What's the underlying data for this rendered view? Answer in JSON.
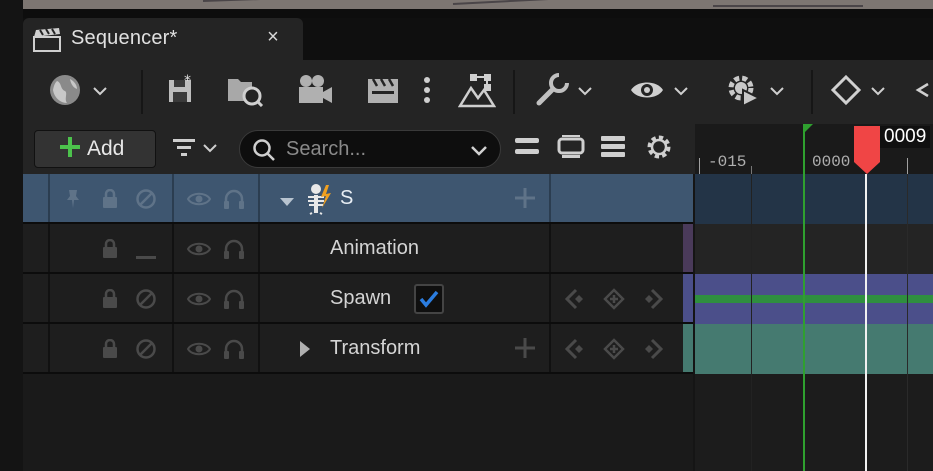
{
  "tab": {
    "title": "Sequencer*",
    "close": "×"
  },
  "toolbar": {
    "items": [
      {
        "name": "world-icon"
      },
      {
        "name": "save-icon"
      },
      {
        "name": "find-asset-icon"
      },
      {
        "name": "camera-icon"
      },
      {
        "name": "clapper-icon"
      },
      {
        "name": "more-icon"
      },
      {
        "name": "render-icon"
      },
      {
        "name": "wrench-icon"
      },
      {
        "name": "eye-icon"
      },
      {
        "name": "gear-play-icon"
      },
      {
        "name": "key-diamond-icon"
      }
    ]
  },
  "filter": {
    "add_label": "Add",
    "search_placeholder": "Search..."
  },
  "outliner": {
    "rows": [
      {
        "label": "S",
        "selected": true,
        "type": "skeletal-actor"
      },
      {
        "label": "Animation"
      },
      {
        "label": "Spawn",
        "checked": true
      },
      {
        "label": "Transform"
      }
    ]
  },
  "timeline": {
    "ticks": [
      "-015",
      "0000"
    ],
    "current_frame": "0009"
  },
  "colors": {
    "selected_row": "#3e5670",
    "animation_track": "#4a3a5a",
    "spawn_track": "#4b4f8a",
    "spawn_bar": "#2f8f3f",
    "transform_track": "#457a70",
    "playhead": "#f04545",
    "checkbox": "#2b7de0"
  }
}
